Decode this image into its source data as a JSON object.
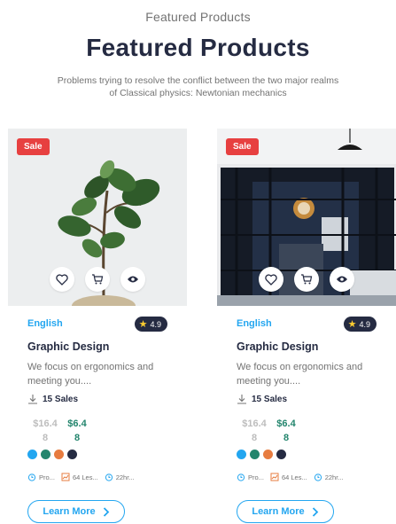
{
  "header": {
    "eyebrow": "Featured Products",
    "title": "Featured Products",
    "subtitle": "Problems trying to resolve the conflict between the two major realms of Classical physics: Newtonian mechanics"
  },
  "colors": {
    "primary": "#23a6f0",
    "heading": "#252b42",
    "sale": "#e74040",
    "price_new": "#23856d",
    "price_old": "#bdbdbd",
    "rating_star": "#ffce31"
  },
  "cards": [
    {
      "image": "potted fig plant",
      "badge": "Sale",
      "category": "English",
      "rating": "4.9",
      "name": "Graphic Design",
      "description": "We focus on ergonomics and meeting you....",
      "sales": "15 Sales",
      "price_old_a": "$16.4",
      "price_old_b": "8",
      "price_new_a": "$6.4",
      "price_new_b": "8",
      "swatches": [
        "#23a6f0",
        "#23856d",
        "#e77c40",
        "#252b42"
      ],
      "meta": [
        "Pro...",
        "64 Les...",
        "22hr..."
      ],
      "cta": "Learn More"
    },
    {
      "image": "room with glass doors",
      "badge": "Sale",
      "category": "English",
      "rating": "4.9",
      "name": "Graphic Design",
      "description": "We focus on ergonomics and meeting you....",
      "sales": "15 Sales",
      "price_old_a": "$16.4",
      "price_old_b": "8",
      "price_new_a": "$6.4",
      "price_new_b": "8",
      "swatches": [
        "#23a6f0",
        "#23856d",
        "#e77c40",
        "#252b42"
      ],
      "meta": [
        "Pro...",
        "64 Les...",
        "22hr..."
      ],
      "cta": "Learn More"
    }
  ]
}
